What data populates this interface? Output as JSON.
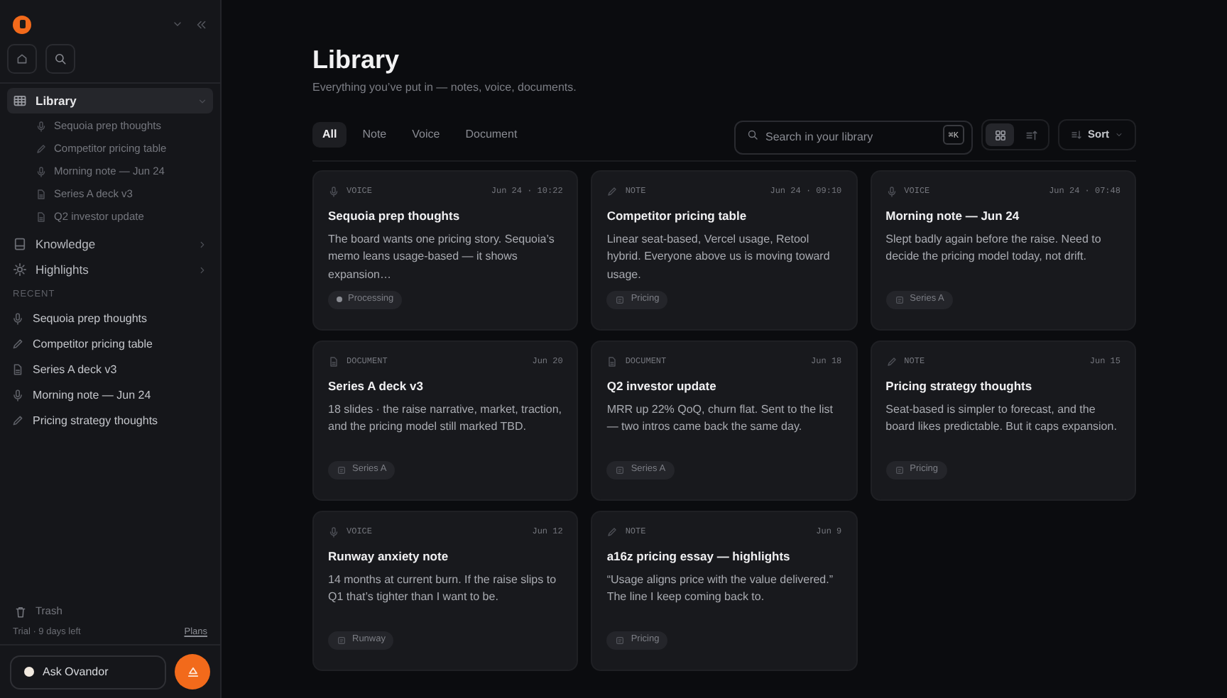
{
  "sidebar": {
    "nav": [
      {
        "label": "Library",
        "kind": "library",
        "selected": true,
        "expanded": true,
        "children": [
          {
            "label": "Sequoia prep thoughts",
            "kind": "voice"
          },
          {
            "label": "Competitor pricing table",
            "kind": "note"
          },
          {
            "label": "Morning note — Jun 24",
            "kind": "voice"
          },
          {
            "label": "Series A deck v3",
            "kind": "document"
          },
          {
            "label": "Q2 investor update",
            "kind": "document"
          }
        ]
      },
      {
        "label": "Knowledge",
        "kind": "knowledge",
        "selected": false,
        "expanded": false
      },
      {
        "label": "Highlights",
        "kind": "highlights",
        "selected": false,
        "expanded": false
      }
    ],
    "recent_heading": "RECENT",
    "recent": [
      {
        "label": "Sequoia prep thoughts",
        "kind": "voice"
      },
      {
        "label": "Competitor pricing table",
        "kind": "note"
      },
      {
        "label": "Series A deck v3",
        "kind": "document"
      },
      {
        "label": "Morning note — Jun 24",
        "kind": "voice"
      },
      {
        "label": "Pricing strategy thoughts",
        "kind": "note"
      }
    ],
    "trash": "Trash",
    "trial": "Trial · 9 days left",
    "plans": "Plans",
    "ask": "Ask Ovandor"
  },
  "header": {
    "title": "Library",
    "subtitle": "Everything you’ve put in — notes, voice, documents."
  },
  "filters": [
    {
      "label": "All",
      "selected": true
    },
    {
      "label": "Note",
      "selected": false
    },
    {
      "label": "Voice",
      "selected": false
    },
    {
      "label": "Document",
      "selected": false
    }
  ],
  "search": {
    "placeholder": "Search in your library",
    "shortcut": "⌘K"
  },
  "view_modes": [
    {
      "kind": "grid",
      "selected": true
    },
    {
      "kind": "list",
      "selected": false
    }
  ],
  "sort": "Sort",
  "cards": [
    {
      "kind": "voice",
      "type_label": "VOICE",
      "time": "Jun 24 · 10:22",
      "title": "Sequoia prep thoughts",
      "body": "The board wants one pricing story. Sequoia’s memo leans usage-based — it shows expansion…",
      "tag": {
        "kind": "status",
        "label": "Processing"
      }
    },
    {
      "kind": "note",
      "type_label": "NOTE",
      "time": "Jun 24 · 09:10",
      "title": "Competitor pricing table",
      "body": "Linear seat-based, Vercel usage, Retool hybrid. Everyone above us is moving toward usage.",
      "tag": {
        "kind": "tag",
        "label": "Pricing"
      }
    },
    {
      "kind": "voice",
      "type_label": "VOICE",
      "time": "Jun 24 · 07:48",
      "title": "Morning note — Jun 24",
      "body": "Slept badly again before the raise. Need to decide the pricing model today, not drift.",
      "tag": {
        "kind": "tag",
        "label": "Series A"
      }
    },
    {
      "kind": "document",
      "type_label": "DOCUMENT",
      "time": "Jun 20",
      "title": "Series A deck v3",
      "body": "18 slides · the raise narrative, market, traction, and the pricing model still marked TBD.",
      "tag": {
        "kind": "tag",
        "label": "Series A"
      }
    },
    {
      "kind": "document",
      "type_label": "DOCUMENT",
      "time": "Jun 18",
      "title": "Q2 investor update",
      "body": "MRR up 22% QoQ, churn flat. Sent to the list — two intros came back the same day.",
      "tag": {
        "kind": "tag",
        "label": "Series A"
      }
    },
    {
      "kind": "note",
      "type_label": "NOTE",
      "time": "Jun 15",
      "title": "Pricing strategy thoughts",
      "body": "Seat-based is simpler to forecast, and the board likes predictable. But it caps expansion.",
      "tag": {
        "kind": "tag",
        "label": "Pricing"
      }
    },
    {
      "kind": "voice",
      "type_label": "VOICE",
      "time": "Jun 12",
      "title": "Runway anxiety note",
      "body": "14 months at current burn. If the raise slips to Q1 that’s tighter than I want to be.",
      "tag": {
        "kind": "tag",
        "label": "Runway"
      }
    },
    {
      "kind": "note",
      "type_label": "NOTE",
      "time": "Jun 9",
      "title": "a16z pricing essay — highlights",
      "body": "“Usage aligns price with the value delivered.” The line I keep coming back to.",
      "tag": {
        "kind": "tag",
        "label": "Pricing"
      }
    }
  ]
}
